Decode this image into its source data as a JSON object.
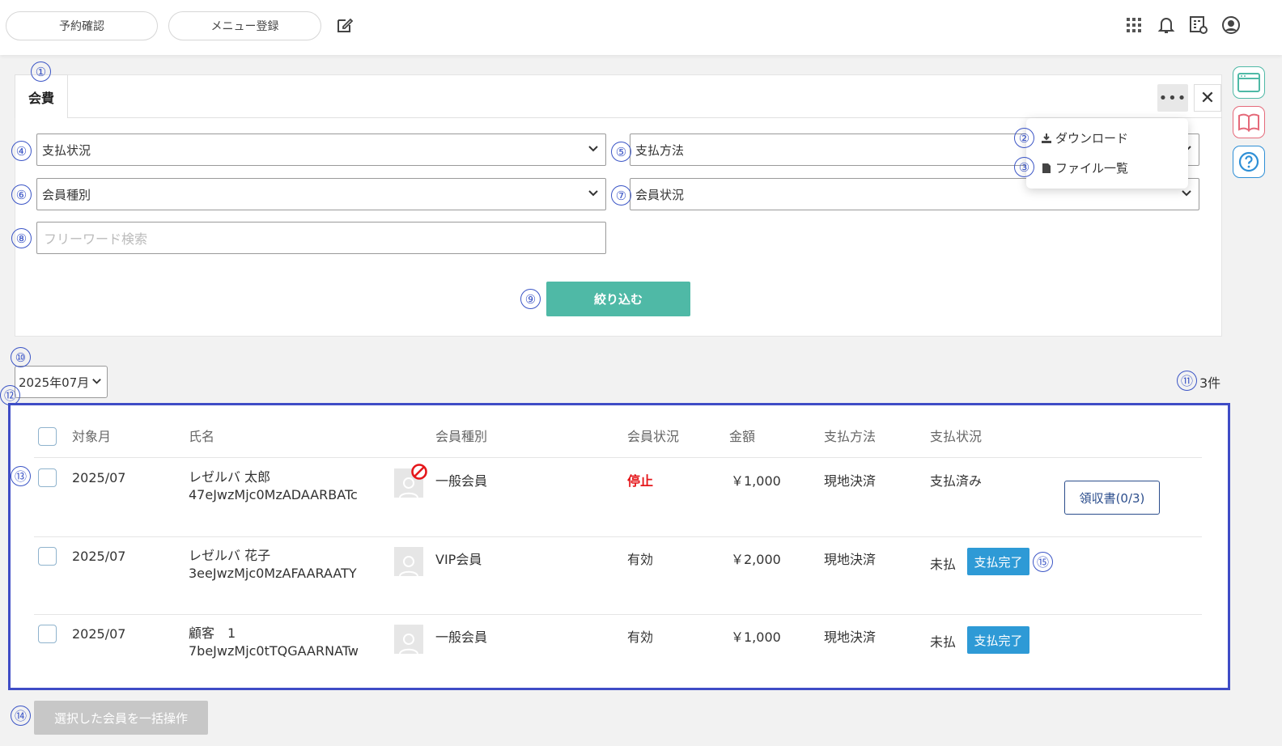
{
  "header": {
    "buttons": [
      "予約確認",
      "メニュー登録"
    ]
  },
  "tab": {
    "label": "会費"
  },
  "menu": {
    "items": [
      "ダウンロード",
      "ファイル一覧"
    ]
  },
  "filters": {
    "payment_status": "支払状況",
    "payment_method": "支払方法",
    "member_type": "会員種別",
    "member_state": "会員状況",
    "search_placeholder": "フリーワード検索",
    "submit": "絞り込む"
  },
  "list": {
    "month": "2025年07月",
    "count": "3件",
    "headers": [
      "対象月",
      "氏名",
      "会員種別",
      "会員状況",
      "金額",
      "支払方法",
      "支払状況"
    ],
    "rows": [
      {
        "month": "2025/07",
        "name": "レゼルバ 太郎",
        "code": "47eJwzMjc0MzADAARBATc",
        "type": "一般会員",
        "state": "停止",
        "amount": "￥1,000",
        "method": "現地決済",
        "status": "支払済み",
        "action": "領収書(0/3)"
      },
      {
        "month": "2025/07",
        "name": "レゼルバ 花子",
        "code": "3eeJwzMjc0MzAFAARAATY",
        "type": "VIP会員",
        "state": "有効",
        "amount": "￥2,000",
        "method": "現地決済",
        "status": "未払",
        "action": "支払完了"
      },
      {
        "month": "2025/07",
        "name": "顧客　1",
        "code": "7beJwzMjc0tTQGAARNATw",
        "type": "一般会員",
        "state": "有効",
        "amount": "￥1,000",
        "method": "現地決済",
        "status": "未払",
        "action": "支払完了"
      }
    ],
    "bulk_action": "選択した会員を一括操作"
  },
  "markers": [
    "①",
    "②",
    "③",
    "④",
    "⑤",
    "⑥",
    "⑦",
    "⑧",
    "⑨",
    "⑩",
    "⑪",
    "⑫",
    "⑬",
    "⑭",
    "⑮"
  ],
  "colors": {
    "accent": "#4fb9a6",
    "pay_button": "#2e9ad6",
    "stopped": "#e5171b",
    "marker": "#3b55c6"
  }
}
